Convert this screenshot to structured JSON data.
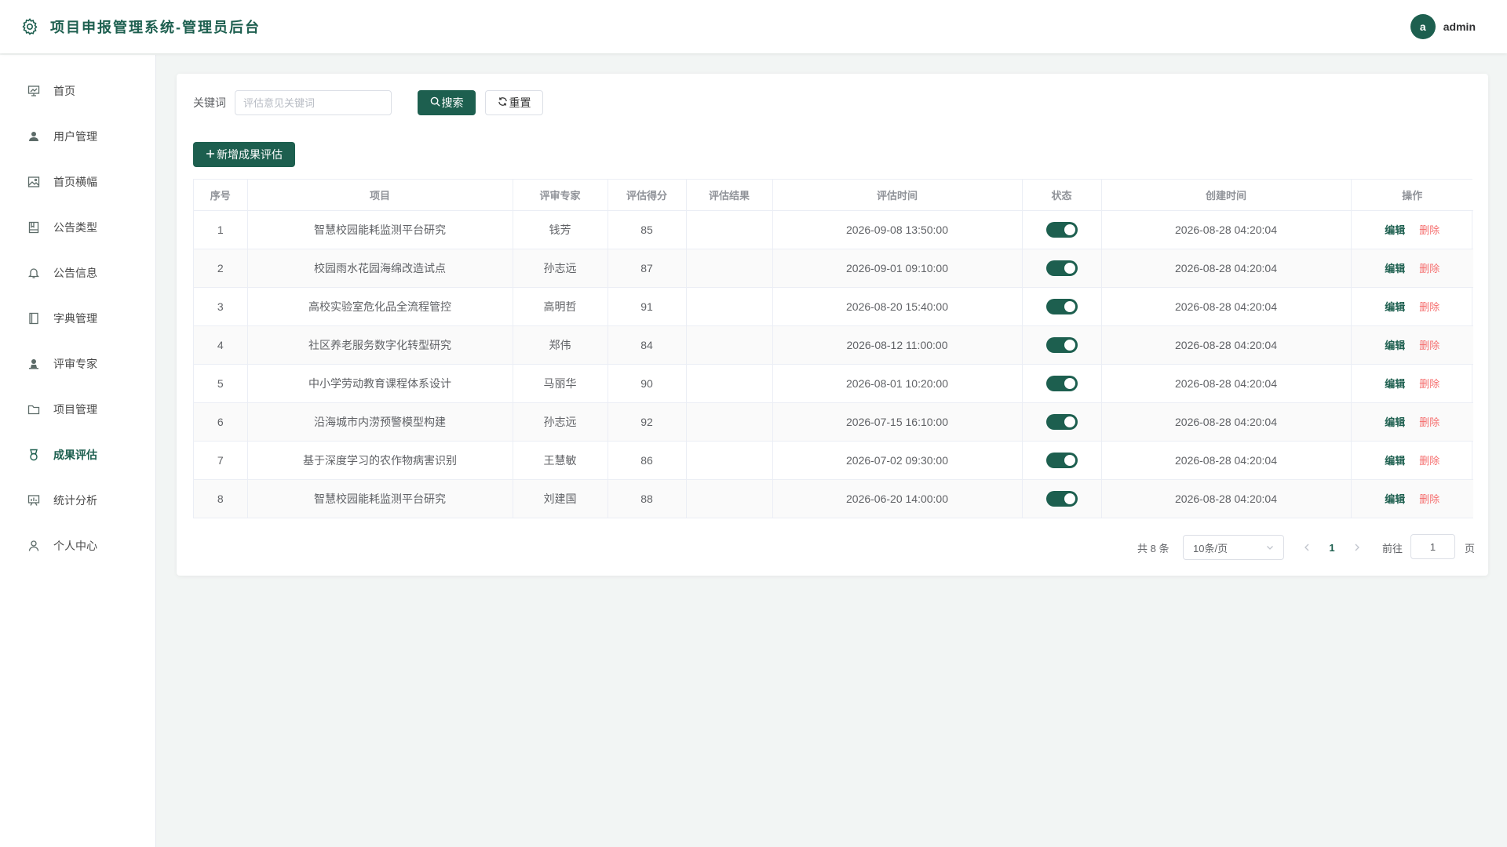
{
  "header": {
    "title": "项目申报管理系统-管理员后台",
    "avatar_letter": "a",
    "username": "admin"
  },
  "sidebar": {
    "items": [
      {
        "label": "首页",
        "icon": "chart-board-icon",
        "active": false
      },
      {
        "label": "用户管理",
        "icon": "user-icon",
        "active": false
      },
      {
        "label": "首页横幅",
        "icon": "image-icon",
        "active": false
      },
      {
        "label": "公告类型",
        "icon": "notebook-icon",
        "active": false
      },
      {
        "label": "公告信息",
        "icon": "bell-icon",
        "active": false
      },
      {
        "label": "字典管理",
        "icon": "book-icon",
        "active": false
      },
      {
        "label": "评审专家",
        "icon": "stamp-user-icon",
        "active": false
      },
      {
        "label": "项目管理",
        "icon": "folder-icon",
        "active": false
      },
      {
        "label": "成果评估",
        "icon": "medal-icon",
        "active": true
      },
      {
        "label": "统计分析",
        "icon": "presentation-icon",
        "active": false
      },
      {
        "label": "个人中心",
        "icon": "profile-icon",
        "active": false
      }
    ]
  },
  "filter": {
    "label": "关键词",
    "placeholder": "评估意见关键词",
    "value": "",
    "search_label": "搜索",
    "reset_label": "重置"
  },
  "toolbar": {
    "add_label": "新增成果评估"
  },
  "table": {
    "columns": [
      "序号",
      "项目",
      "评审专家",
      "评估得分",
      "评估结果",
      "评估时间",
      "状态",
      "创建时间",
      "操作"
    ],
    "rows": [
      {
        "index": "1",
        "project": "智慧校园能耗监测平台研究",
        "expert": "钱芳",
        "score": "85",
        "result": "",
        "eval_time": "2026-09-08 13:50:00",
        "status": true,
        "created": "2026-08-28 04:20:04"
      },
      {
        "index": "2",
        "project": "校园雨水花园海绵改造试点",
        "expert": "孙志远",
        "score": "87",
        "result": "",
        "eval_time": "2026-09-01 09:10:00",
        "status": true,
        "created": "2026-08-28 04:20:04"
      },
      {
        "index": "3",
        "project": "高校实验室危化品全流程管控",
        "expert": "高明哲",
        "score": "91",
        "result": "",
        "eval_time": "2026-08-20 15:40:00",
        "status": true,
        "created": "2026-08-28 04:20:04"
      },
      {
        "index": "4",
        "project": "社区养老服务数字化转型研究",
        "expert": "郑伟",
        "score": "84",
        "result": "",
        "eval_time": "2026-08-12 11:00:00",
        "status": true,
        "created": "2026-08-28 04:20:04"
      },
      {
        "index": "5",
        "project": "中小学劳动教育课程体系设计",
        "expert": "马丽华",
        "score": "90",
        "result": "",
        "eval_time": "2026-08-01 10:20:00",
        "status": true,
        "created": "2026-08-28 04:20:04"
      },
      {
        "index": "6",
        "project": "沿海城市内涝预警模型构建",
        "expert": "孙志远",
        "score": "92",
        "result": "",
        "eval_time": "2026-07-15 16:10:00",
        "status": true,
        "created": "2026-08-28 04:20:04"
      },
      {
        "index": "7",
        "project": "基于深度学习的农作物病害识别",
        "expert": "王慧敏",
        "score": "86",
        "result": "",
        "eval_time": "2026-07-02 09:30:00",
        "status": true,
        "created": "2026-08-28 04:20:04"
      },
      {
        "index": "8",
        "project": "智慧校园能耗监测平台研究",
        "expert": "刘建国",
        "score": "88",
        "result": "",
        "eval_time": "2026-06-20 14:00:00",
        "status": true,
        "created": "2026-08-28 04:20:04"
      }
    ],
    "edit_label": "编辑",
    "delete_label": "删除"
  },
  "pagination": {
    "total_text": "共 8 条",
    "page_size": "10条/页",
    "current_page": "1",
    "goto_label": "前往",
    "goto_value": "1",
    "page_unit": "页"
  },
  "colors": {
    "accent": "#1d5f4f",
    "danger": "#f56c6c"
  }
}
